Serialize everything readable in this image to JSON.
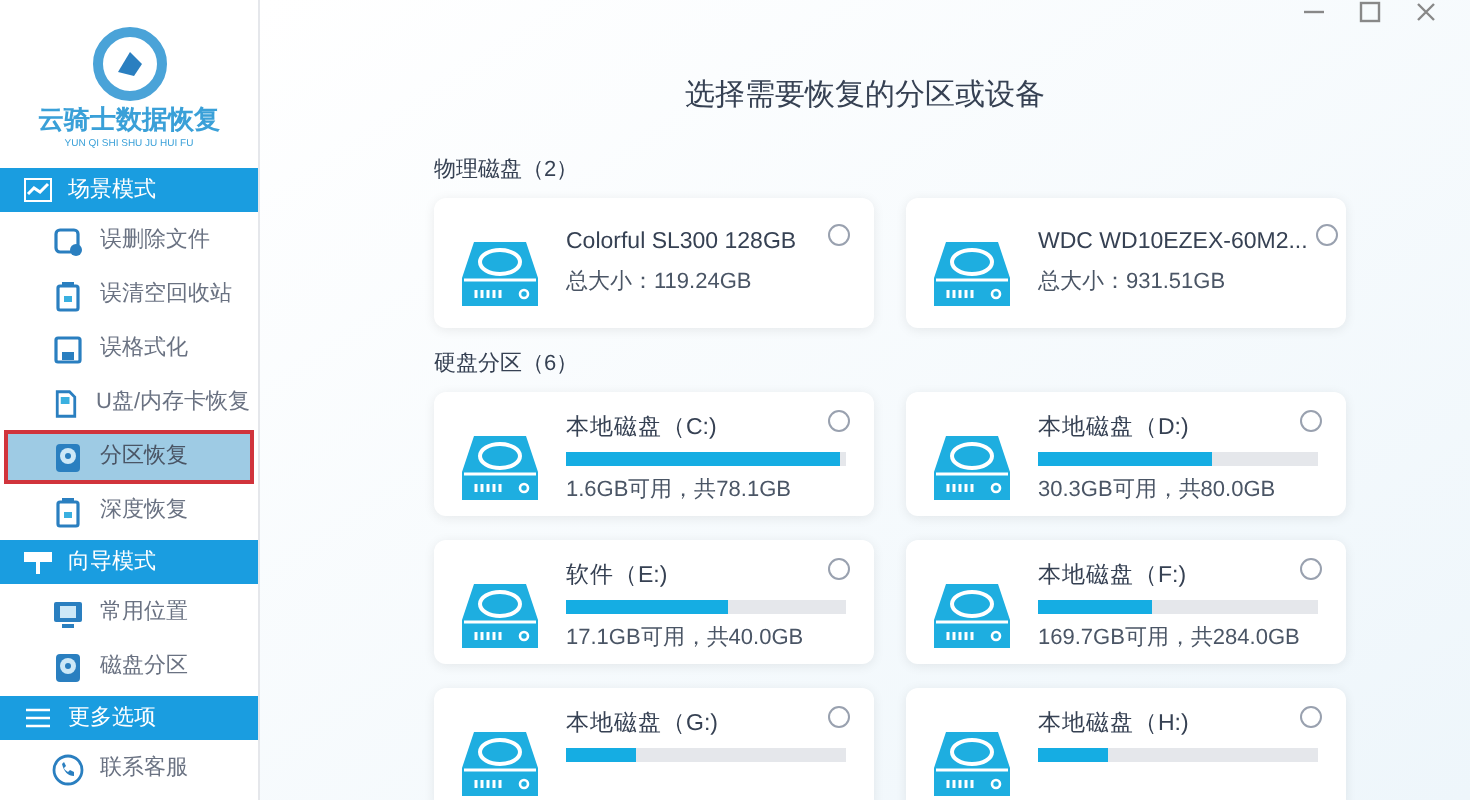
{
  "logo": {
    "title": "云骑士数据恢复",
    "subtitle": "YUN QI SHI SHU JU HUI FU"
  },
  "sidebar": {
    "sections": [
      {
        "title": "场景模式",
        "items": [
          {
            "label": "误删除文件",
            "selected": false
          },
          {
            "label": "误清空回收站",
            "selected": false
          },
          {
            "label": "误格式化",
            "selected": false
          },
          {
            "label": "U盘/内存卡恢复",
            "selected": false
          },
          {
            "label": "分区恢复",
            "selected": true
          },
          {
            "label": "深度恢复",
            "selected": false
          }
        ]
      },
      {
        "title": "向导模式",
        "items": [
          {
            "label": "常用位置",
            "selected": false
          },
          {
            "label": "磁盘分区",
            "selected": false
          }
        ]
      },
      {
        "title": "更多选项",
        "items": [
          {
            "label": "联系客服",
            "selected": false
          }
        ]
      }
    ]
  },
  "main": {
    "heading": "选择需要恢复的分区或设备",
    "groups": [
      {
        "title": "物理磁盘（2）",
        "devices": [
          {
            "kind": "disk",
            "name": "Colorful SL300 128GB",
            "detail": "总大小：119.24GB",
            "selected": false
          },
          {
            "kind": "disk",
            "name": "WDC WD10EZEX-60M2...",
            "detail": "总大小：931.51GB",
            "selected": false
          }
        ]
      },
      {
        "title": "硬盘分区（6）",
        "devices": [
          {
            "kind": "partition",
            "name": "本地磁盘（C:)",
            "level": 0.98,
            "detail": "1.6GB可用，共78.1GB",
            "selected": false
          },
          {
            "kind": "partition",
            "name": "本地磁盘（D:)",
            "level": 0.62,
            "detail": "30.3GB可用，共80.0GB",
            "selected": false
          },
          {
            "kind": "partition",
            "name": "软件（E:)",
            "level": 0.58,
            "detail": "17.1GB可用，共40.0GB",
            "selected": false
          },
          {
            "kind": "partition",
            "name": "本地磁盘（F:)",
            "level": 0.41,
            "detail": "169.7GB可用，共284.0GB",
            "selected": false
          },
          {
            "kind": "partition",
            "name": "本地磁盘（G:)",
            "level": 0.25,
            "selected": false
          },
          {
            "kind": "partition",
            "name": "本地磁盘（H:)",
            "level": 0.25,
            "selected": false
          }
        ]
      }
    ]
  }
}
